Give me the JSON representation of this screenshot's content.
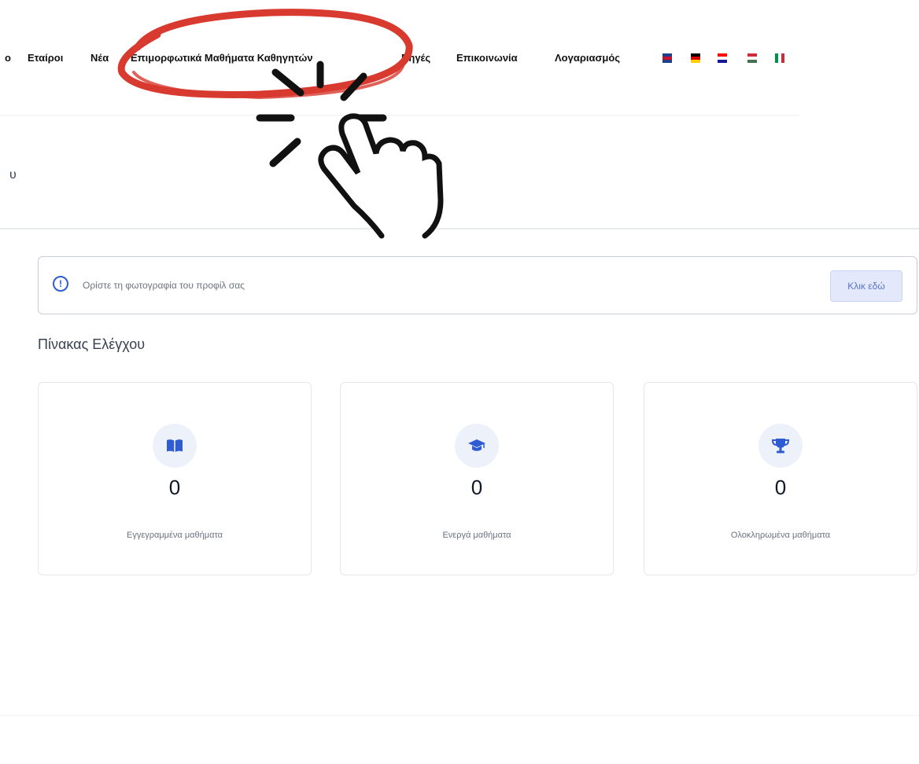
{
  "nav": {
    "items": [
      {
        "label": "ο"
      },
      {
        "label": "Εταίροι"
      },
      {
        "label": "Νέα"
      },
      {
        "label": "Επιμορφωτικά Μαθήματα Καθηγητών"
      },
      {
        "label": "Πηγές"
      },
      {
        "label": "Επικοινωνία"
      },
      {
        "label": "Λογαριασμός"
      }
    ],
    "flags": [
      {
        "name": "uk-flag-icon",
        "colors": [
          "#1f3e8a",
          "#ffffff",
          "#c8102e"
        ]
      },
      {
        "name": "germany-flag-icon",
        "colors": [
          "#000000",
          "#dd0000",
          "#ffce00"
        ]
      },
      {
        "name": "croatia-flag-icon",
        "colors": [
          "#ff0000",
          "#ffffff",
          "#171796"
        ]
      },
      {
        "name": "hungary-flag-icon",
        "colors": [
          "#ce2939",
          "#ffffff",
          "#477050"
        ]
      },
      {
        "name": "italy-flag-icon",
        "colors": [
          "#009246",
          "#ffffff",
          "#ce2b37"
        ]
      }
    ]
  },
  "page": {
    "partial_heading": "υ"
  },
  "alert": {
    "icon": "info-icon",
    "text": "Ορίστε τη φωτογραφία του προφίλ σας",
    "button_label": "Κλικ εδώ"
  },
  "dashboard": {
    "title": "Πίνακας Ελέγχου",
    "cards": [
      {
        "icon": "book-icon",
        "value": "0",
        "label": "Εγγεγραμμένα μαθήματα"
      },
      {
        "icon": "graduation-cap-icon",
        "value": "0",
        "label": "Ενεργά μαθήματα"
      },
      {
        "icon": "trophy-icon",
        "value": "0",
        "label": "Ολοκληρωμένα μαθήματα"
      }
    ]
  },
  "colors": {
    "accent": "#2f5bd3",
    "annotation": "#d83a2f"
  }
}
